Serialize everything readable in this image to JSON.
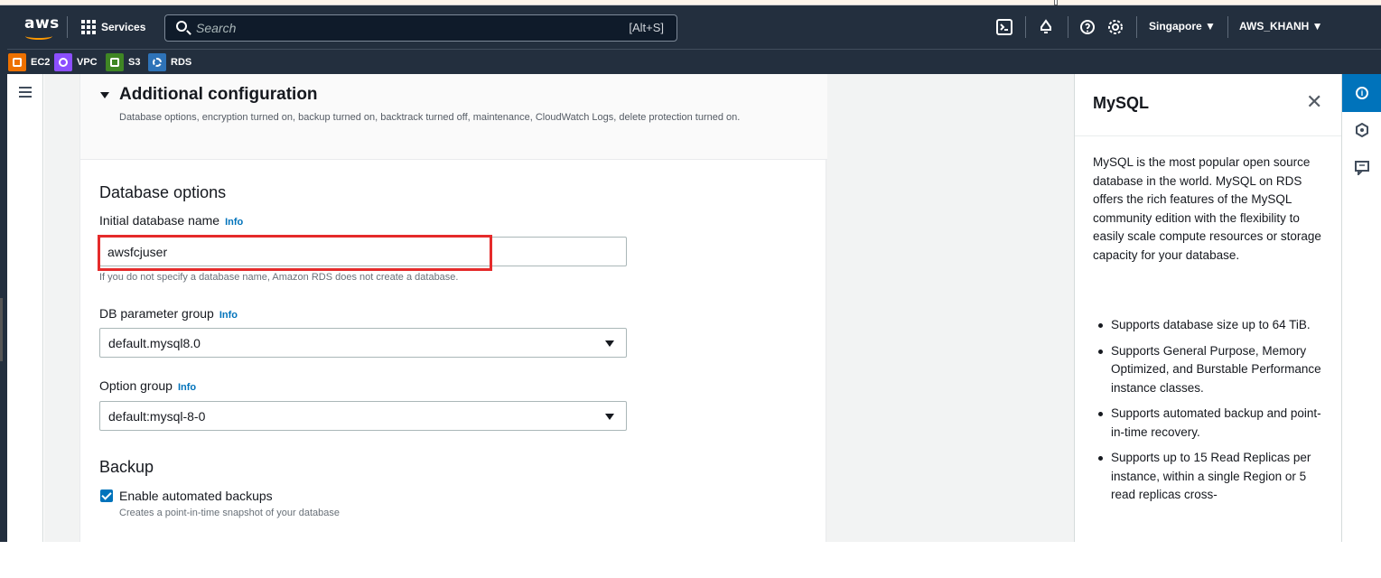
{
  "topnav": {
    "logo": "aws",
    "services_label": "Services",
    "search_placeholder": "Search",
    "search_shortcut": "[Alt+S]",
    "region": "Singapore ▼",
    "account": "AWS_KHANH ▼"
  },
  "favorites": [
    {
      "label": "EC2",
      "color": "#ed7100"
    },
    {
      "label": "VPC",
      "color": "#8c4fff"
    },
    {
      "label": "S3",
      "color": "#3f8624"
    },
    {
      "label": "RDS",
      "color": "#2e73b8"
    }
  ],
  "section": {
    "title": "Additional configuration",
    "description": "Database options, encryption turned on, backup turned on, backtrack turned off, maintenance, CloudWatch Logs, delete protection turned on."
  },
  "database_options": {
    "heading": "Database options",
    "initial_db_label": "Initial database name",
    "initial_db_info": "Info",
    "initial_db_value": "awsfcjuser",
    "initial_db_helper": "If you do not specify a database name, Amazon RDS does not create a database.",
    "param_group_label": "DB parameter group",
    "param_group_info": "Info",
    "param_group_value": "default.mysql8.0",
    "option_group_label": "Option group",
    "option_group_info": "Info",
    "option_group_value": "default:mysql-8-0"
  },
  "backup": {
    "heading": "Backup",
    "enable_label": "Enable automated backups",
    "enable_checked": true,
    "enable_helper": "Creates a point-in-time snapshot of your database"
  },
  "help": {
    "title": "MySQL",
    "close": "✕",
    "body": "MySQL is the most popular open source database in the world. MySQL on RDS offers the rich features of the MySQL community edition with the flexibility to easily scale compute resources or storage capacity for your database.",
    "bullets": [
      "Supports database size up to 64 TiB.",
      "Supports General Purpose, Memory Optimized, and Burstable Performance instance classes.",
      "Supports automated backup and point-in-time recovery.",
      "Supports up to 15 Read Replicas per instance, within a single Region or 5 read replicas cross-"
    ]
  },
  "colors": {
    "nav_bg": "#232f3e",
    "link_blue": "#0073bb",
    "highlight_red": "#e52b2b"
  }
}
